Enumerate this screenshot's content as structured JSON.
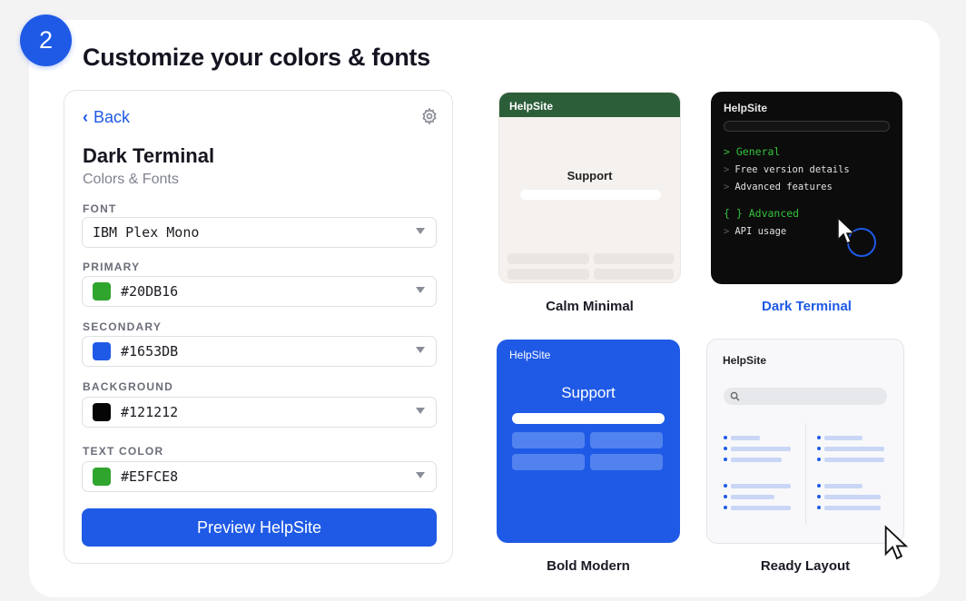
{
  "step_number": "2",
  "page_title": "Customize your colors & fonts",
  "panel": {
    "back_label": "Back",
    "theme_title": "Dark Terminal",
    "theme_subtitle": "Colors & Fonts",
    "font": {
      "label": "FONT",
      "value": "IBM Plex Mono"
    },
    "fields": [
      {
        "label": "PRIMARY",
        "value": "#20DB16",
        "swatch": "#2fa52d"
      },
      {
        "label": "SECONDARY",
        "value": "#1653DB",
        "swatch": "#1f5ae6"
      },
      {
        "label": "BACKGROUND",
        "value": "#121212",
        "swatch": "#050505"
      },
      {
        "label": "TEXT COLOR",
        "value": "#E5FCE8",
        "swatch": "#2fa52d"
      }
    ],
    "preview_button": "Preview HelpSite"
  },
  "themes": {
    "calm_minimal": {
      "label": "Calm Minimal",
      "brand": "HelpSite",
      "heading": "Support"
    },
    "dark_terminal": {
      "label": "Dark Terminal",
      "brand": "HelpSite",
      "lines": [
        {
          "prefix": ">",
          "text": "General"
        },
        {
          "prefix": ">",
          "text": "Free version details"
        },
        {
          "prefix": ">",
          "text": "Advanced features"
        },
        {
          "prefix": "{ }",
          "text": "Advanced"
        },
        {
          "prefix": ">",
          "text": "API usage"
        }
      ]
    },
    "bold_modern": {
      "label": "Bold Modern",
      "brand": "HelpSite",
      "heading": "Support"
    },
    "ready_layout": {
      "label": "Ready Layout",
      "brand": "HelpSite"
    }
  },
  "colors": {
    "accent": "#1f5ae6",
    "selected_label": "#1f5ae6",
    "terminal_green": "#36c23d"
  }
}
